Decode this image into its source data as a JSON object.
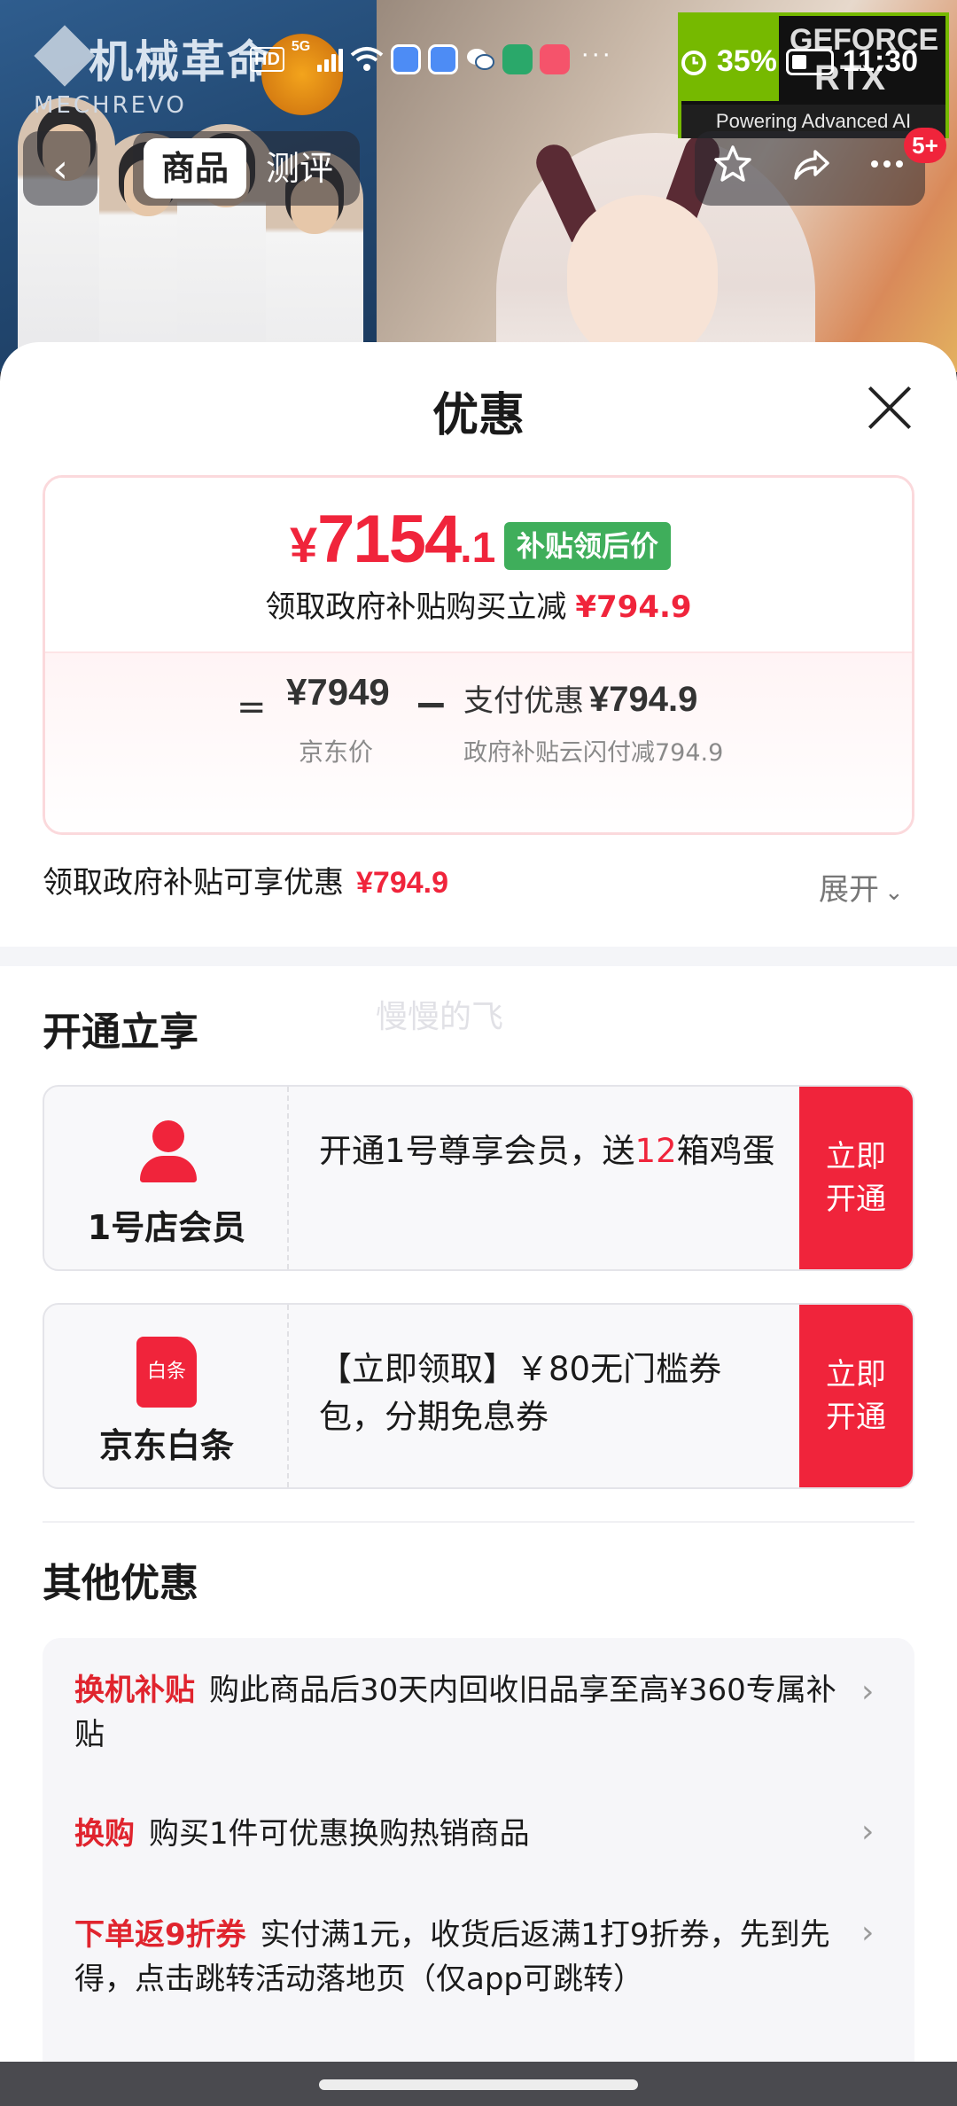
{
  "status_bar": {
    "network_hd": "HD",
    "network_5g": "5G",
    "more_dots": "···",
    "battery": "35%",
    "time": "11:30"
  },
  "banner": {
    "brand_name": "机械革命",
    "brand_sub": "MECHREVO",
    "nvidia_title": "GEFORCE",
    "nvidia_rtx": "RTX",
    "nvidia_tagline": "Powering Advanced AI"
  },
  "nav": {
    "back_icon": "‹",
    "tab_product": "商品",
    "tab_review": "测评",
    "badge": "5+"
  },
  "sheet": {
    "title": "优惠",
    "price_card": {
      "currency": "¥",
      "price_main": "7154",
      "price_decimal": ".1",
      "subsidy_tag": "补贴领后价",
      "subsidy_line": "领取政府补贴购买立减",
      "subsidy_amount": "¥794.9",
      "equals": "=",
      "jd_price": "¥7949",
      "jd_label": "京东价",
      "minus": "−",
      "pay_label": "支付优惠",
      "pay_amount": "¥794.9",
      "pay_desc": "政府补贴云闪付减794.9"
    },
    "enjoy_label": "领取政府补贴可享优惠",
    "enjoy_amount": "¥794.9",
    "expand_label": "展开",
    "watermark": "慢慢的飞",
    "open_title": "开通立享",
    "cards": [
      {
        "name": "1号店会员",
        "text_pre": "开通1号尊享会员，送",
        "text_hl": "12",
        "text_post": "箱鸡蛋",
        "button": "立即开通"
      },
      {
        "name": "京东白条",
        "icon_label": "白条",
        "text_pre": "【立即领取】￥80无门槛券包，分期免息券",
        "text_hl": "",
        "text_post": "",
        "button": "立即开通"
      }
    ],
    "other_title": "其他优惠",
    "promos": [
      {
        "tag": "换机补贴",
        "text": "购此商品后30天内回收旧品享至高¥360专属补贴"
      },
      {
        "tag": "换购",
        "text": "购买1件可优惠换购热销商品"
      },
      {
        "tag": "下单返9折券",
        "text": "实付满1元，收货后返满1打9折券，先到先得，点击跳转活动落地页（仅app可跳转）"
      }
    ]
  },
  "colors": {
    "accent_red": "#f0243b",
    "subsidy_green": "#3fae5b"
  }
}
